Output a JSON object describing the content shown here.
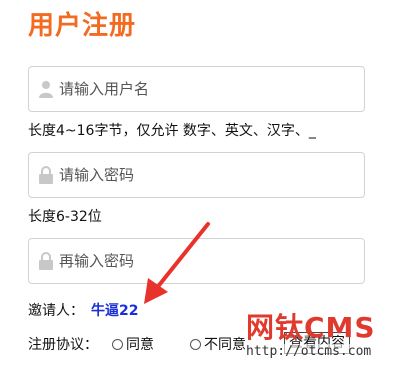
{
  "page": {
    "title": "用户注册"
  },
  "form": {
    "username_placeholder": "请输入用户名",
    "username_hint": "长度4~16字节，仅允许 数字、英文、汉字、_",
    "password_placeholder": "请输入密码",
    "password_hint": "长度6-32位",
    "confirm_placeholder": "再输入密码",
    "inviter_label": "邀请人：",
    "inviter_name": "牛逼22",
    "agreement_label": "注册协议：",
    "agree_option": "同意",
    "disagree_option": "不同意",
    "view_button": "查看内容"
  },
  "watermark": {
    "logo_text": "网钛CMS",
    "url": "http://otcms.com"
  },
  "colors": {
    "title": "#f36b21",
    "inviter_name": "#1a2fd6",
    "arrow": "#e8322c",
    "watermark": "#e03a2e"
  },
  "icons": {
    "username": "user-icon",
    "password": "lock-icon",
    "confirm": "lock-icon"
  }
}
